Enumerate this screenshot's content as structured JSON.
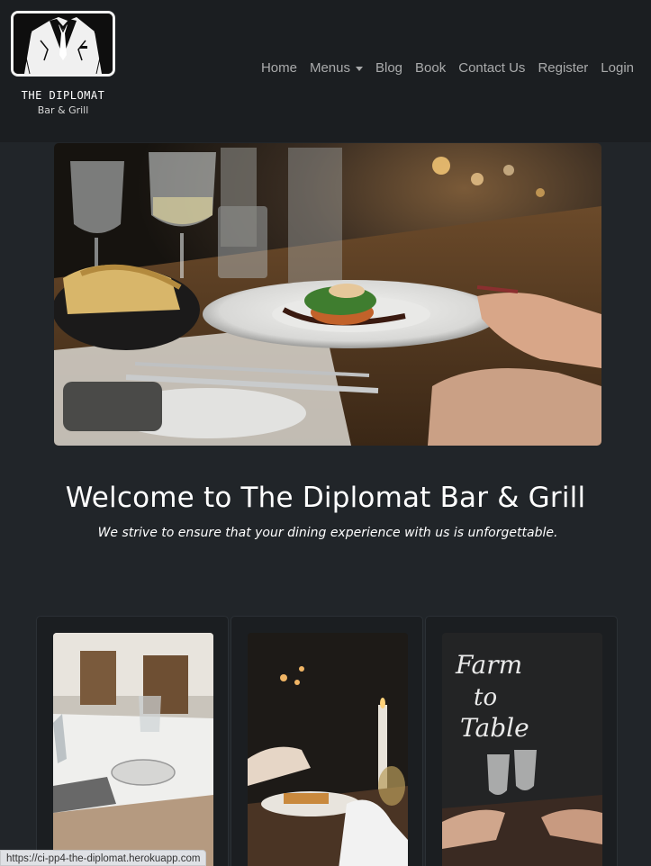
{
  "brand": {
    "name": "THE DIPLOMAT",
    "subtitle": "Bar & Grill"
  },
  "nav": {
    "home": "Home",
    "menus": "Menus",
    "blog": "Blog",
    "book": "Book",
    "contact": "Contact Us",
    "register": "Register",
    "login": "Login"
  },
  "hero": {
    "title": "Welcome to The Diplomat Bar & Grill",
    "tagline": "We strive to ensure that your dining experience with us is unforgettable."
  },
  "status_url": "https://ci-pp4-the-diplomat.herokuapp.com",
  "colors": {
    "page_bg": "#212529",
    "navbar_bg": "#1b1e21",
    "nav_text": "#a6a8aa"
  }
}
